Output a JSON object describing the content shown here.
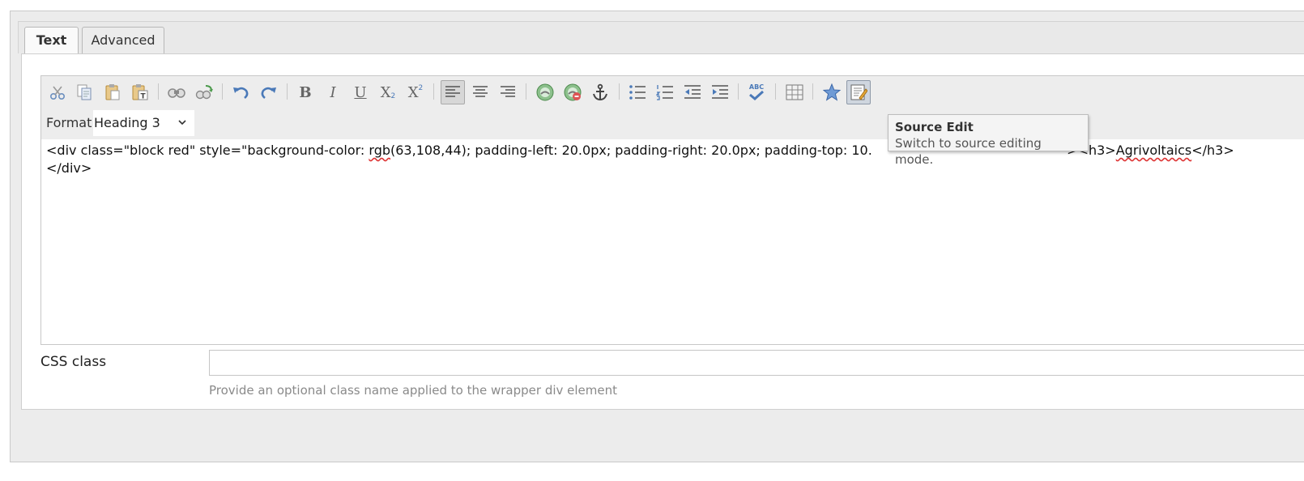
{
  "tabs": [
    {
      "label": "Text",
      "active": true
    },
    {
      "label": "Advanced",
      "active": false
    }
  ],
  "toolbar": {
    "buttons": [
      "cut-icon",
      "copy-icon",
      "paste-icon",
      "paste-text-icon",
      "find-icon",
      "replace-icon",
      "undo-icon",
      "redo-icon",
      "bold-icon",
      "italic-icon",
      "underline-icon",
      "subscript-icon",
      "superscript-icon",
      "align-left-icon",
      "align-center-icon",
      "align-right-icon",
      "link-icon",
      "unlink-icon",
      "anchor-icon",
      "bullet-list-icon",
      "numbered-list-icon",
      "outdent-icon",
      "indent-icon",
      "spellcheck-icon",
      "table-icon",
      "special-char-icon",
      "source-edit-icon"
    ],
    "bold_glyph": "B",
    "italic_glyph": "I",
    "underline_glyph": "U",
    "subscript_glyph": "X",
    "subscript_mark": "2",
    "superscript_glyph": "X",
    "superscript_mark": "2",
    "spellcheck_text": "ABC"
  },
  "format": {
    "label": "Format",
    "selected": "Heading 3"
  },
  "source": {
    "line1_a": "<div class=\"block red\" style=\"background-color: ",
    "line1_b": "rgb",
    "line1_c": "(63,108,44); padding-left: 20.0px; padding-right: 20.0px; padding-top: 10.",
    "line1_d": "\"><h3>",
    "line1_e": "Agrivoltaics",
    "line1_f": "</h3>",
    "line2": "</div>"
  },
  "tooltip": {
    "title": "Source Edit",
    "description": "Switch to source editing mode."
  },
  "css_class": {
    "label": "CSS class",
    "value": "",
    "help": "Provide an optional class name applied to the wrapper div element"
  },
  "colors": {
    "toolbar_bg": "#ededed",
    "panel_bg": "#ececec",
    "icon_blue": "#4a79b8",
    "icon_green": "#4c9a4c",
    "icon_red": "#c44"
  }
}
